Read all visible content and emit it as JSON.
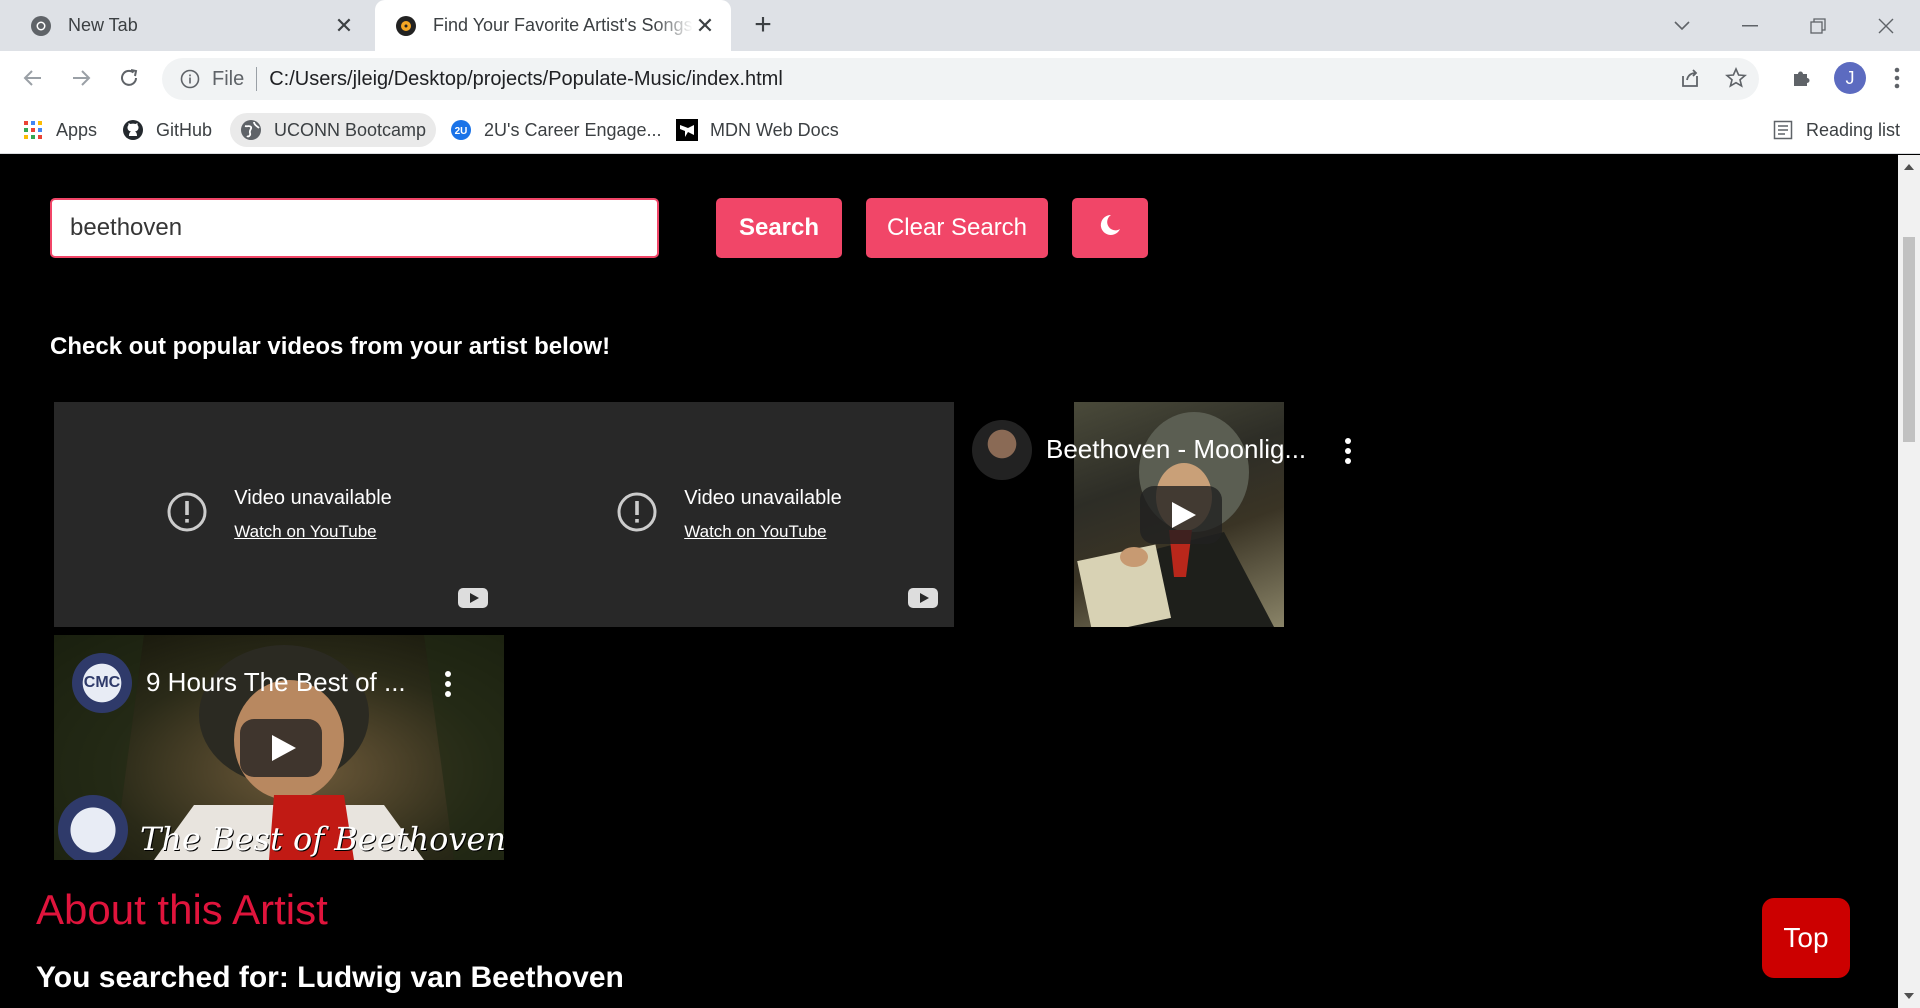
{
  "browser": {
    "tabs": [
      {
        "label": "New Tab",
        "active": false
      },
      {
        "label": "Find Your Favorite Artist's Songs",
        "active": true
      }
    ],
    "omnibox": {
      "scheme_label": "File",
      "url": "C:/Users/jleig/Desktop/projects/Populate-Music/index.html"
    },
    "profile_initial": "J",
    "bookmarks": [
      {
        "label": "Apps",
        "icon": "apps-grid-icon"
      },
      {
        "label": "GitHub",
        "icon": "github-icon"
      },
      {
        "label": "UCONN Bootcamp",
        "icon": "globe-icon"
      },
      {
        "label": "2U's Career Engage...",
        "icon": "2u-icon"
      },
      {
        "label": "MDN Web Docs",
        "icon": "mdn-icon"
      }
    ],
    "reading_list": "Reading list"
  },
  "page": {
    "search": {
      "value": "beethoven",
      "placeholder": ""
    },
    "buttons": {
      "search": "Search",
      "clear": "Clear Search",
      "theme_icon": "moon-icon"
    },
    "subtitle": "Check out popular videos from your artist below!",
    "videos": [
      {
        "state": "unavailable",
        "title": "Video unavailable",
        "link": "Watch on YouTube"
      },
      {
        "state": "unavailable",
        "title": "Video unavailable",
        "link": "Watch on YouTube"
      },
      {
        "state": "playable",
        "title": "Beethoven - Moonlig..."
      },
      {
        "state": "playable",
        "title": "9 Hours The Best of ...",
        "overlay_text": "The Best of Beethoven",
        "channel_badge": "CMC"
      }
    ],
    "about_heading": "About this Artist",
    "searched_for": "You searched for: Ludwig van Beethoven",
    "top_button": "Top",
    "colors": {
      "accent": "#f14668",
      "heading": "#e0143c",
      "top_button": "#cc0000",
      "background": "#000000"
    }
  }
}
